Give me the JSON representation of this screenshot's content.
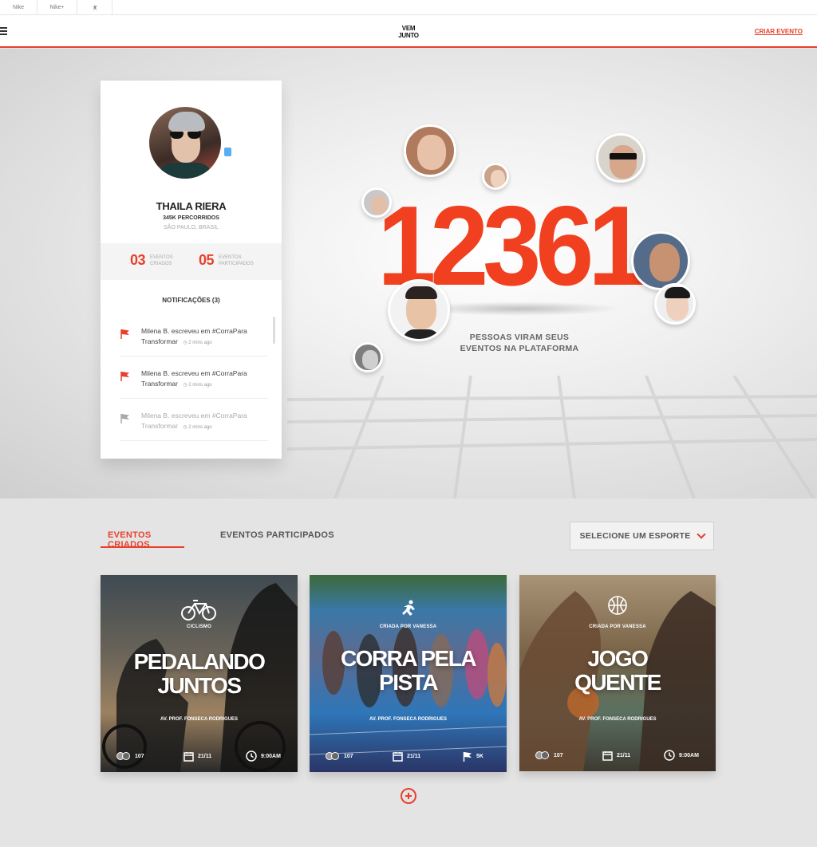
{
  "topbar": {
    "items": [
      "Nike",
      "Nike+"
    ],
    "jordan_icon": "jumpman-icon"
  },
  "header": {
    "logo_line1": "VEM",
    "logo_line2": "JUNTO",
    "cta": "CRIAR EVENTO",
    "menu_icon": "hamburger-icon"
  },
  "profile": {
    "name": "THAILA RIERA",
    "km": "345K PERCORRIDOS",
    "location": "SÃO PAULO, BRASIL",
    "stats": [
      {
        "value": "03",
        "label": "EVENTOS CRIADOS"
      },
      {
        "value": "05",
        "label": "EVENTOS PARTICIPADOS"
      }
    ],
    "notifications_title": "NOTIFICAÇÕES (3)",
    "notifications": [
      {
        "line1": "Milena B. escreveu em #CorraPara",
        "line2": "Transformar",
        "time": "2 mins ago",
        "read": false
      },
      {
        "line1": "Milena B. escreveu em #CorraPara",
        "line2": "Transformar",
        "time": "2 mins ago",
        "read": false
      },
      {
        "line1": "Milena B. escreveu em #CorraPara",
        "line2": "Transformar",
        "time": "2 mins ago",
        "read": true
      }
    ]
  },
  "hero": {
    "count": "12361",
    "subtitle_line1": "PESSOAS VIRAM SEUS",
    "subtitle_line2": "EVENTOS NA PLATAFORMA",
    "accent": "#f0401f"
  },
  "tabs": {
    "created": "EVENTOS CRIADOS",
    "participated": "EVENTOS PARTICIPADOS",
    "select": "SELECIONE UM ESPORTE"
  },
  "events": [
    {
      "label": "CICLISMO",
      "title1": "PEDALANDO",
      "title2": "JUNTOS",
      "address": "AV. PROF. FONSECA RODRIGUES",
      "people": "107",
      "date": "21/11",
      "extra": "9:00AM",
      "icon": "bicycle-icon"
    },
    {
      "label": "CRIADA POR VANESSA",
      "title1": "CORRA PELA",
      "title2": "PISTA",
      "address": "AV. PROF. FONSECA RODRIGUES",
      "people": "107",
      "date": "21/11",
      "extra": "5K",
      "icon": "runner-icon"
    },
    {
      "label": "CRIADA POR VANESSA",
      "title1": "JOGO",
      "title2": "QUENTE",
      "address": "AV. PROF. FONSECA RODRIGUES",
      "people": "107",
      "date": "21/11",
      "extra": "9:00AM",
      "icon": "basketball-icon"
    }
  ]
}
